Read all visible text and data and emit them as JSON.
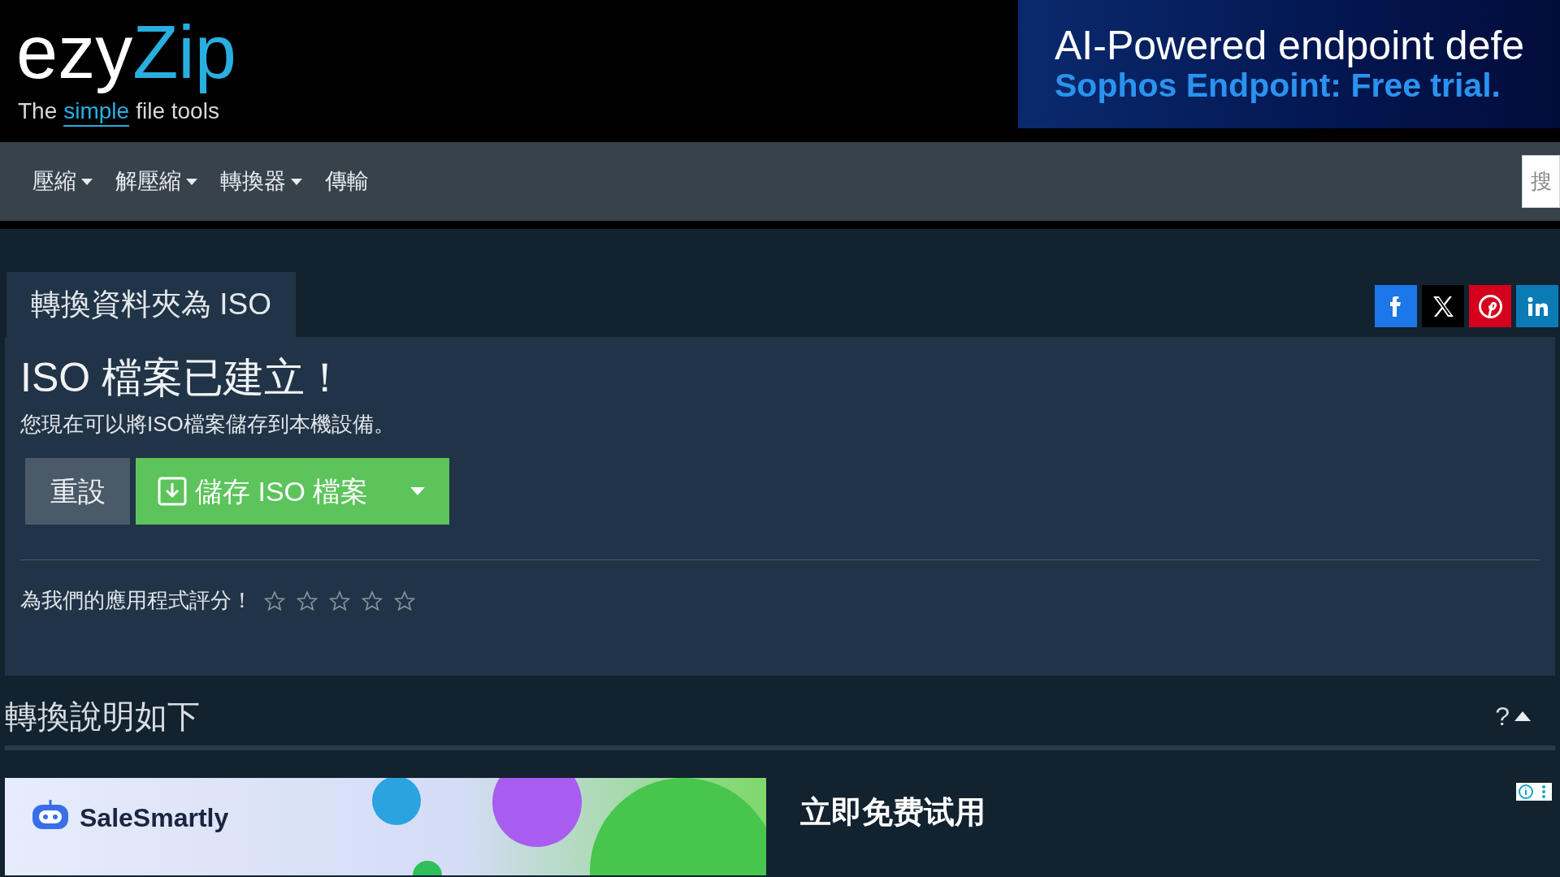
{
  "logo": {
    "name_part1": "ezy",
    "name_part2": "Zip",
    "tagline_before": "The",
    "tagline_highlight": "simple",
    "tagline_after": "file tools"
  },
  "top_ad": {
    "headline": "AI-Powered endpoint defe",
    "subline": "Sophos Endpoint: Free trial."
  },
  "nav": {
    "items": [
      {
        "label": "壓縮",
        "dropdown": true
      },
      {
        "label": "解壓縮",
        "dropdown": true
      },
      {
        "label": "轉換器",
        "dropdown": true
      },
      {
        "label": "傳輸",
        "dropdown": false
      }
    ],
    "search": {
      "placeholder": "搜"
    }
  },
  "tab": {
    "label": "轉換資料夾為 ISO"
  },
  "share": [
    {
      "kind": "facebook"
    },
    {
      "kind": "x"
    },
    {
      "kind": "pinterest"
    },
    {
      "kind": "linkedin"
    }
  ],
  "result": {
    "title": "ISO 檔案已建立！",
    "message": "您現在可以將ISO檔案儲存到本機設備。",
    "reset_button": "重設",
    "save_button": "儲存 ISO 檔案"
  },
  "rating": {
    "label": "為我們的應用程式評分！",
    "stars": 0
  },
  "section": {
    "title": "轉換說明如下",
    "help": "?",
    "expanded": true
  },
  "bottom_ad": {
    "brand": "SaleSmartly",
    "headline": "立即免费试用"
  }
}
